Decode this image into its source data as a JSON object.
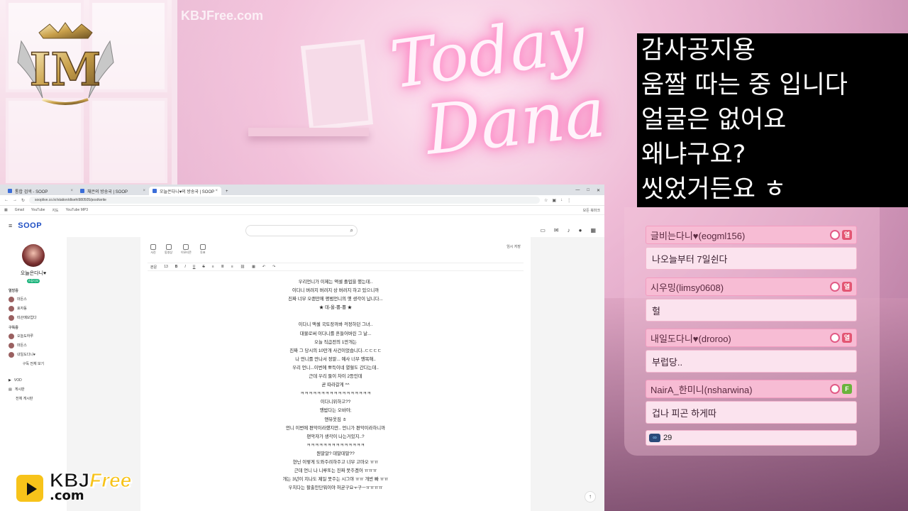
{
  "watermark_top": "KBJFree.com",
  "neon_sign": {
    "line1": "Today",
    "line2": "Dana"
  },
  "logo_monogram": "IM",
  "notice": {
    "lines": [
      "감사공지용",
      "움짤 따는 중 입니다",
      "얼굴은 없어요",
      "왜냐구요?",
      "씻었거든요 ㅎ"
    ]
  },
  "chat": {
    "messages": [
      {
        "nick": "글비는다니♥(eogml156)",
        "text": "나오늘부터 7일쉰다",
        "badges": [
          "heart",
          "열"
        ]
      },
      {
        "nick": "시우밍(limsy0608)",
        "text": "헐",
        "badges": [
          "heart",
          "열"
        ]
      },
      {
        "nick": "내일도다니♥(droroo)",
        "text": "부럽당..",
        "badges": [
          "heart",
          "열"
        ]
      },
      {
        "nick": "NairA_한미니(nsharwina)",
        "text": "겁나 피곤 하게따",
        "badges": [
          "heart",
          "F"
        ]
      }
    ],
    "viewer_count": "29"
  },
  "browser": {
    "tabs": [
      {
        "label": "통합 검색 - SOOP",
        "active": false
      },
      {
        "label": "채은의 방송국 | SOOP",
        "active": false
      },
      {
        "label": "오늘은다니♥의 방송국 | SOOP",
        "active": true
      }
    ],
    "url": "sooplive.co.kr/station/dtsehi980505/post/write",
    "bookmarks": [
      "Gmail",
      "YouTube",
      "지도",
      "YouTube MP3"
    ],
    "bookmark_folder": "모든 북마크",
    "logo": "SOOP",
    "sidebar": {
      "profile_name": "오늘은다니♥",
      "live_label": "스튜디오",
      "section_hot": "열방중",
      "hot_items": [
        "마돈스",
        "효자동",
        "따끈메모업다"
      ],
      "section_sub": "구독중",
      "sub_items": [
        "오늘도하루",
        "마돈스",
        "내일도다니♥"
      ],
      "more_label": "구독 전체 보기",
      "vod_label": "VOD",
      "board_label": "게시판",
      "board_all": "전체 게시판"
    },
    "editor": {
      "tools": [
        "사진",
        "동영상",
        "이모티콘",
        "투표"
      ],
      "save_label": "임시 저장",
      "format_items": [
        "본문",
        "13",
        "B",
        "I",
        "U",
        "S"
      ],
      "body_lines": [
        "우리언니가 이제는 액셀 졸업을 했는데..",
        "이다니 버려지 버려지 상 버러지 하고 있으니까",
        "진짜 너무 오랜만에 평범언니의 옛 생각이 납니다...",
        "★ 데-올-뿅-뿅 ★",
        "",
        "이다니 액셀 국토장까봐 걱정하던 그녀..",
        "대물로써 이다니를 흔들어버린 그 날...",
        "오늘 직급전의 1만개는",
        "진짜 그 당시의 10만개 사건이었습니다..ㄷㄷㄷㄷ",
        "나 언니를 만나서 정말... 예사 너무 행복해..",
        "우리 언니...이번에 뽀득이네 열혈도 간다는데..",
        "근데 우리 둘이 차이 2등인데",
        "곧 따라갈게 ^^",
        "ㅋㅋㅋㅋㅋㅋㅋㅋㅋㅋㅋㅋㅋㅋㅋㅋㅋ",
        "이다니위하고??",
        "행밥다는 오바야;",
        "앤뮤옷짐 ㅎ",
        "언니 이번에 편악이라했지만.. 언니가 편악이라하니까",
        "편악쟈가 생각이 나는거있지..?",
        "ㅋㅋㅋㅋㅋㅋㅋㅋㅋㅋㅋㅋㅋㅋ",
        "뭔말알? 데말데말??",
        "현닌 이렇게 도와주려하주고 너무 고마오 ㅠㅠ",
        "근데 언니 나 니루또는 진짜 못주겠어 ㅠㅠㅠ",
        "개는 3년이 지나도 제일 못주는 시그야 ㅠㅠ 개반 빠 ㅠㅠ",
        "우치다는 팔출안단뭐이야 허굳구요ㅜ구ㅡㅠㅠㅠㅠ"
      ]
    }
  },
  "kbj": {
    "main": "KBJ",
    "free": "Free",
    "com": ".com"
  },
  "colors": {
    "notice_bg": "#000000",
    "chat_head": "#f7bcd4",
    "soop_blue": "#1f4fc4"
  }
}
